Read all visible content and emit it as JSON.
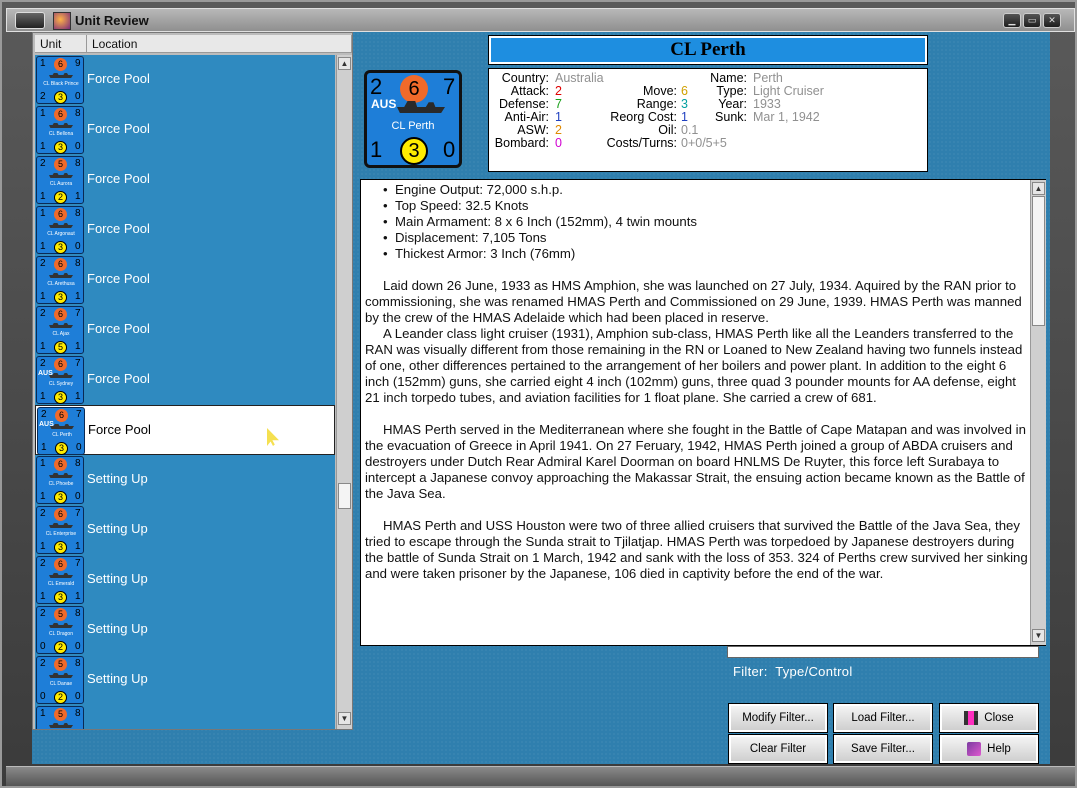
{
  "window": {
    "title": "Unit Review"
  },
  "list": {
    "col_unit": "Unit",
    "col_location": "Location",
    "rows": [
      {
        "tl": "1",
        "tr": "9",
        "orange": "6",
        "name": "CL Black Prince",
        "bl": "2",
        "br": "0",
        "yellow": "3",
        "nat": "",
        "loc": "Force Pool"
      },
      {
        "tl": "1",
        "tr": "8",
        "orange": "6",
        "name": "CL Bellona",
        "bl": "1",
        "br": "0",
        "yellow": "3",
        "nat": "",
        "loc": "Force Pool"
      },
      {
        "tl": "2",
        "tr": "8",
        "orange": "5",
        "name": "CL Aurora",
        "bl": "1",
        "br": "1",
        "yellow": "2",
        "nat": "",
        "loc": "Force Pool"
      },
      {
        "tl": "1",
        "tr": "8",
        "orange": "6",
        "name": "CL Argonaut",
        "bl": "1",
        "br": "0",
        "yellow": "3",
        "nat": "",
        "loc": "Force Pool"
      },
      {
        "tl": "2",
        "tr": "8",
        "orange": "6",
        "name": "CL Arethusa",
        "bl": "1",
        "br": "1",
        "yellow": "3",
        "nat": "",
        "loc": "Force Pool"
      },
      {
        "tl": "2",
        "tr": "7",
        "orange": "6",
        "name": "CL Ajax",
        "bl": "1",
        "br": "1",
        "yellow": "5",
        "nat": "",
        "loc": "Force Pool"
      },
      {
        "tl": "2",
        "tr": "7",
        "orange": "6",
        "name": "CL Sydney",
        "bl": "1",
        "br": "1",
        "yellow": "3",
        "nat": "AUS",
        "loc": "Force Pool"
      },
      {
        "tl": "2",
        "tr": "7",
        "orange": "6",
        "name": "CL Perth",
        "bl": "1",
        "br": "0",
        "yellow": "3",
        "nat": "AUS",
        "loc": "Force Pool",
        "selected": true
      },
      {
        "tl": "1",
        "tr": "8",
        "orange": "6",
        "name": "CL Phoebe",
        "bl": "1",
        "br": "0",
        "yellow": "3",
        "nat": "",
        "loc": "Setting Up"
      },
      {
        "tl": "2",
        "tr": "7",
        "orange": "6",
        "name": "CL Enterprise",
        "bl": "1",
        "br": "1",
        "yellow": "3",
        "nat": "",
        "loc": "Setting Up"
      },
      {
        "tl": "2",
        "tr": "7",
        "orange": "6",
        "name": "CL Emerald",
        "bl": "1",
        "br": "1",
        "yellow": "3",
        "nat": "",
        "loc": "Setting Up"
      },
      {
        "tl": "2",
        "tr": "8",
        "orange": "5",
        "name": "CL Dragon",
        "bl": "0",
        "br": "0",
        "yellow": "2",
        "nat": "",
        "loc": "Setting Up"
      },
      {
        "tl": "2",
        "tr": "8",
        "orange": "5",
        "name": "CL Danae",
        "bl": "0",
        "br": "0",
        "yellow": "2",
        "nat": "",
        "loc": "Setting Up"
      },
      {
        "tl": "1",
        "tr": "8",
        "orange": "5",
        "name": "",
        "bl": "",
        "br": "",
        "yellow": "",
        "nat": "",
        "loc": ""
      }
    ]
  },
  "unit": {
    "title": "CL Perth",
    "counter": {
      "tl": "2",
      "orange": "6",
      "tr": "7",
      "nat": "AUS",
      "name": "CL Perth",
      "bl": "1",
      "yellow": "3",
      "br": "0"
    },
    "stats": {
      "country_label": "Country:",
      "country": "Australia",
      "attack_label": "Attack:",
      "attack": "2",
      "defense_label": "Defense:",
      "defense": "7",
      "antiair_label": "Anti-Air:",
      "antiair": "1",
      "asw_label": "ASW:",
      "asw": "2",
      "bombard_label": "Bombard:",
      "bombard": "0",
      "move_label": "Move:",
      "move": "6",
      "range_label": "Range:",
      "range": "3",
      "reorg_label": "Reorg Cost:",
      "reorg": "1",
      "oil_label": "Oil:",
      "oil": "0.1",
      "costs_label": "Costs/Turns:",
      "costs": "0+0/5+5",
      "name_label": "Name:",
      "name": "Perth",
      "type_label": "Type:",
      "type": "Light Cruiser",
      "year_label": "Year:",
      "year": "1933",
      "sunk_label": "Sunk:",
      "sunk": "Mar 1, 1942"
    },
    "bullets": [
      "Engine Output: 72,000 s.h.p.",
      "Top Speed: 32.5 Knots",
      "Main Armament: 8 x 6 Inch (152mm), 4 twin mounts",
      "Displacement: 7,105 Tons",
      "Thickest Armor: 3 Inch (76mm)"
    ],
    "paragraphs": [
      "Laid down 26 June, 1933 as HMS Amphion, she was launched on 27 July, 1934.  Aquired by the RAN prior to commissioning, she was renamed HMAS Perth and Commissioned on 29 June, 1939. HMAS Perth was manned by the crew of the HMAS Adelaide which had been placed in reserve.",
      "A Leander class light cruiser (1931), Amphion sub-class, HMAS Perth like all the Leanders transferred to the RAN was visually different from those remaining in the RN or Loaned to New Zealand having two funnels instead of one, other differences pertained to the arrangement of her boilers and power plant.  In addition to the eight 6 inch (152mm) guns, she carried eight 4 inch (102mm) guns, three quad 3 pounder mounts for AA defense, eight 21 inch torpedo tubes, and aviation facilities for 1 float plane.  She carried a crew of 681.",
      "HMAS Perth served in the Mediterranean where she fought in the Battle of Cape Matapan and was involved in the evacuation of Greece in April 1941.  On 27 Feruary, 1942, HMAS Perth joined a group of ABDA cruisers and destroyers under Dutch Rear Admiral Karel Doorman on board HNLMS De Ruyter, this force left Surabaya to intercept a Japanese convoy approaching the Makassar Strait, the ensuing action became known as the Battle of the Java Sea.",
      "HMAS Perth and USS Houston were two of three allied cruisers that survived the Battle of the Java Sea, they tried to escape through the Sunda strait to Tjilatjap.  HMAS Perth was torpedoed by Japanese destroyers during the battle of Sunda Strait on 1 March, 1942 and sank with the loss of 353.  324 of Perths crew survived her sinking and were taken prisoner by the Japanese, 106 died in captivity before the end of the war."
    ]
  },
  "filter": {
    "label": "Filter:",
    "value": "Type/Control"
  },
  "buttons": {
    "modify": "Modify Filter...",
    "load": "Load Filter...",
    "close": "Close",
    "clear": "Clear Filter",
    "save": "Save Filter...",
    "help": "Help"
  },
  "colors": {
    "attack": "#e00000",
    "defense": "#18a018",
    "antiair": "#2040c0",
    "asw": "#e08a00",
    "bombard": "#d000d0",
    "move": "#d0a000",
    "range": "#00a0a0",
    "reorg": "#2040c0",
    "grey": "#909090"
  }
}
